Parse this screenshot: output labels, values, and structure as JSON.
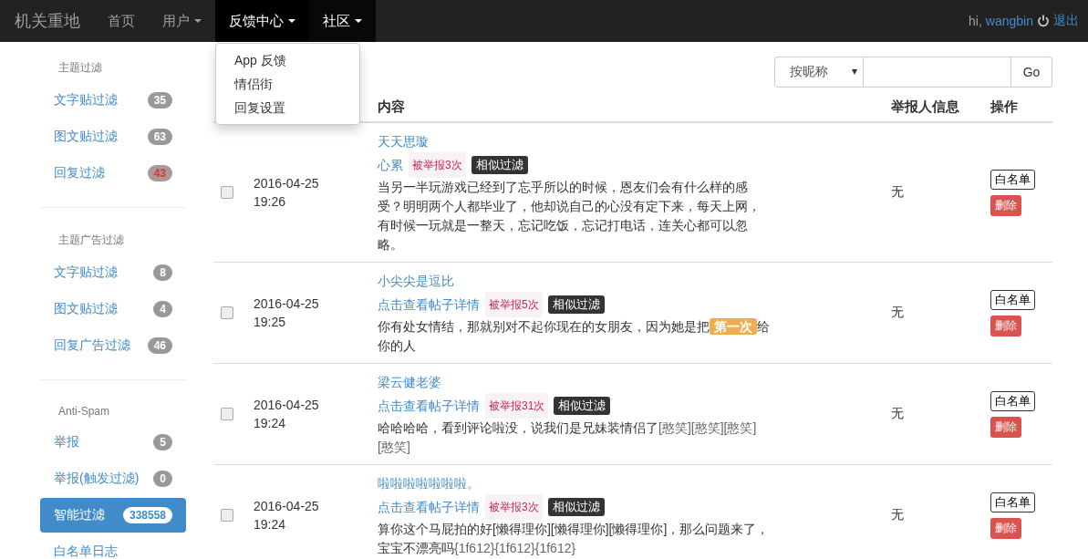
{
  "navbar": {
    "brand": "机关重地",
    "items": [
      {
        "label": "首页",
        "dropdown": false,
        "selected": false,
        "open": false
      },
      {
        "label": "用户",
        "dropdown": true,
        "selected": false,
        "open": false
      },
      {
        "label": "反馈中心",
        "dropdown": true,
        "selected": true,
        "open": true,
        "menu": [
          "App 反馈",
          "情侣街",
          "回复设置"
        ]
      },
      {
        "label": "社区",
        "dropdown": true,
        "selected": true,
        "open": false
      }
    ],
    "greeting": "hi,",
    "username": "wangbin",
    "logout": "退出"
  },
  "sidebar": {
    "sections": [
      {
        "header": "主题过滤",
        "items": [
          {
            "label": "文字贴过滤",
            "badge": "35",
            "alert": false,
            "selected": false
          },
          {
            "label": "图文贴过滤",
            "badge": "63",
            "alert": false,
            "selected": false
          },
          {
            "label": "回复过滤",
            "badge": "43",
            "alert": true,
            "selected": false
          }
        ]
      },
      {
        "header": "主题广告过滤",
        "items": [
          {
            "label": "文字贴过滤",
            "badge": "8",
            "alert": false,
            "selected": false
          },
          {
            "label": "图文贴过滤",
            "badge": "4",
            "alert": false,
            "selected": false
          },
          {
            "label": "回复广告过滤",
            "badge": "46",
            "alert": false,
            "selected": false
          }
        ]
      },
      {
        "header": "Anti-Spam",
        "items": [
          {
            "label": "举报",
            "badge": "5",
            "alert": false,
            "selected": false
          },
          {
            "label": "举报(触发过滤)",
            "badge": "0",
            "alert": false,
            "selected": false
          },
          {
            "label": "智能过滤",
            "badge": "338558",
            "alert": false,
            "selected": true
          },
          {
            "label": "白名单日志",
            "selected": false
          }
        ]
      }
    ]
  },
  "search": {
    "select": "按昵称",
    "button": "Go"
  },
  "table": {
    "columns": [
      "内容",
      "举报人信息",
      "操作"
    ],
    "rows": [
      {
        "checked": false,
        "date": "2016-04-25",
        "time": "19:26",
        "title": "天天思璇",
        "meta": [
          {
            "kind": "link",
            "text": "心累"
          },
          {
            "kind": "reports",
            "text": "被举报3次"
          },
          {
            "kind": "tag",
            "text": "相似过滤"
          }
        ],
        "body": [
          {
            "kind": "plain",
            "text": "当另一半玩游戏已经到了忘乎所以的时候，恩友们会有什么样的感受？明明两个人都毕业了，他却说自己的心没有定下来，每天上网，有时候一玩就是一整天，忘记吃饭，忘记打电话，连关心都可以忽略。"
          }
        ],
        "reporter": "无",
        "whitelist": "白名单",
        "delete": "删除"
      },
      {
        "checked": false,
        "date": "2016-04-25",
        "time": "19:25",
        "title": "小尖尖是逗比",
        "meta": [
          {
            "kind": "link",
            "text": "点击查看帖子详情"
          },
          {
            "kind": "reports",
            "text": "被举报5次"
          },
          {
            "kind": "tag",
            "text": "相似过滤"
          }
        ],
        "body": [
          {
            "kind": "plain",
            "text": "你有处女情结，那就别对不起你现在的女朋友，因为她是把"
          },
          {
            "kind": "highlight",
            "text": "第一次"
          },
          {
            "kind": "plain",
            "text": "给你的人"
          }
        ],
        "reporter": "无",
        "whitelist": "白名单",
        "delete": "删除"
      },
      {
        "checked": false,
        "date": "2016-04-25",
        "time": "19:24",
        "title": "梁云健老婆",
        "meta": [
          {
            "kind": "link",
            "text": "点击查看帖子详情"
          },
          {
            "kind": "reports",
            "text": "被举报31次"
          },
          {
            "kind": "tag",
            "text": "相似过滤"
          }
        ],
        "body": [
          {
            "kind": "plain",
            "text": "哈哈哈哈，看到评论啦没，说我们是兄妹装情侣了"
          },
          {
            "kind": "code",
            "text": "[憨笑][憨笑][憨笑][憨笑]"
          }
        ],
        "reporter": "无",
        "whitelist": "白名单",
        "delete": "删除"
      },
      {
        "checked": false,
        "date": "2016-04-25",
        "time": "19:24",
        "title": "啦啦啦啦啦啦啦。",
        "meta": [
          {
            "kind": "link",
            "text": "点击查看帖子详情"
          },
          {
            "kind": "reports",
            "text": "被举报3次"
          },
          {
            "kind": "tag",
            "text": "相似过滤"
          }
        ],
        "body": [
          {
            "kind": "plain",
            "text": "算你这个马屁拍的好[懒得理你][懒得理你][懒得理你]，那么问题来了，宝宝不漂亮吗"
          },
          {
            "kind": "code",
            "text": "{1f612}{1f612}{1f612}"
          }
        ],
        "reporter": "无",
        "whitelist": "白名单",
        "delete": "删除"
      }
    ]
  }
}
